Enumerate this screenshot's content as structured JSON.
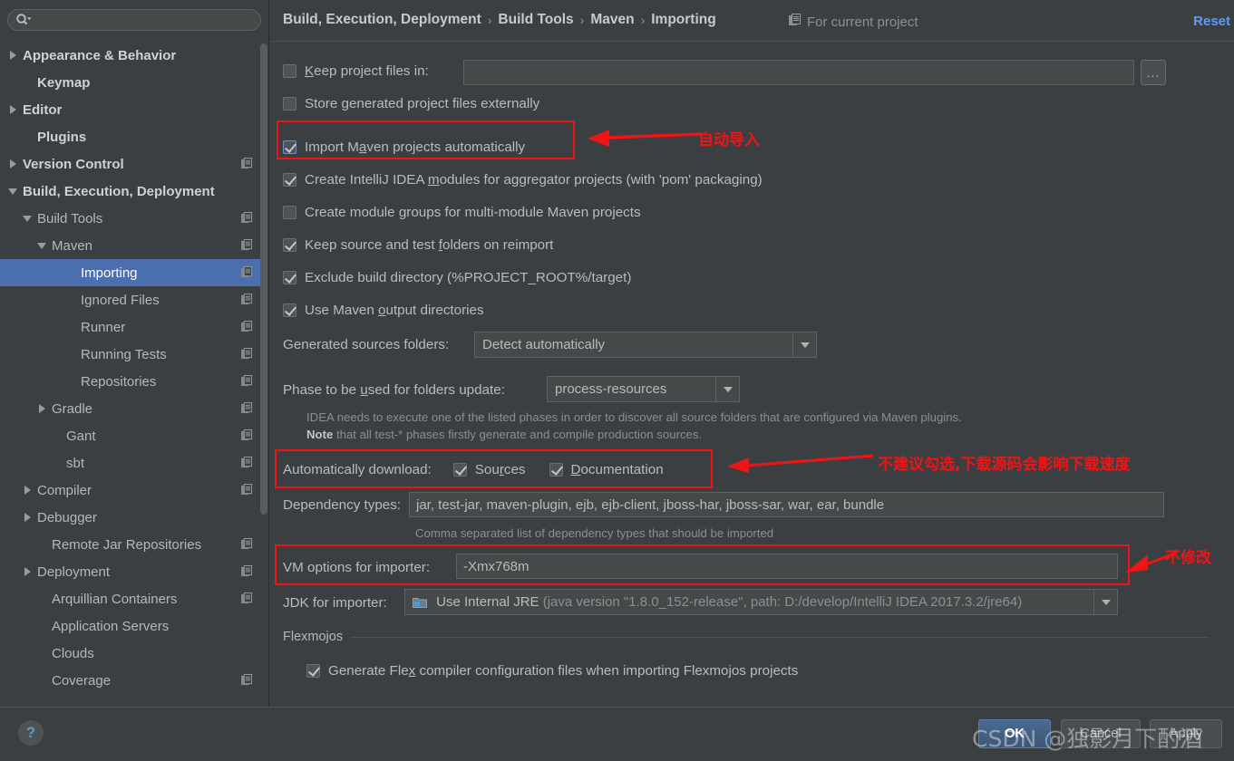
{
  "window": {
    "search_placeholder": "",
    "search_value": ""
  },
  "sidebar": {
    "items": [
      {
        "label": "Appearance & Behavior",
        "indent": 0,
        "arrow": "collapsed",
        "bold": true,
        "copy": false,
        "selected": false
      },
      {
        "label": "Keymap",
        "indent": 1,
        "arrow": "none",
        "bold": true,
        "copy": false,
        "selected": false
      },
      {
        "label": "Editor",
        "indent": 0,
        "arrow": "collapsed",
        "bold": true,
        "copy": false,
        "selected": false
      },
      {
        "label": "Plugins",
        "indent": 1,
        "arrow": "none",
        "bold": true,
        "copy": false,
        "selected": false
      },
      {
        "label": "Version Control",
        "indent": 0,
        "arrow": "collapsed",
        "bold": true,
        "copy": true,
        "selected": false
      },
      {
        "label": "Build, Execution, Deployment",
        "indent": 0,
        "arrow": "expanded",
        "bold": true,
        "copy": false,
        "selected": false
      },
      {
        "label": "Build Tools",
        "indent": 1,
        "arrow": "expanded",
        "bold": false,
        "copy": true,
        "selected": false
      },
      {
        "label": "Maven",
        "indent": 2,
        "arrow": "expanded",
        "bold": false,
        "copy": true,
        "selected": false
      },
      {
        "label": "Importing",
        "indent": 4,
        "arrow": "none",
        "bold": false,
        "copy": true,
        "selected": true
      },
      {
        "label": "Ignored Files",
        "indent": 4,
        "arrow": "none",
        "bold": false,
        "copy": true,
        "selected": false
      },
      {
        "label": "Runner",
        "indent": 4,
        "arrow": "none",
        "bold": false,
        "copy": true,
        "selected": false
      },
      {
        "label": "Running Tests",
        "indent": 4,
        "arrow": "none",
        "bold": false,
        "copy": true,
        "selected": false
      },
      {
        "label": "Repositories",
        "indent": 4,
        "arrow": "none",
        "bold": false,
        "copy": true,
        "selected": false
      },
      {
        "label": "Gradle",
        "indent": 2,
        "arrow": "collapsed",
        "bold": false,
        "copy": true,
        "selected": false
      },
      {
        "label": "Gant",
        "indent": 3,
        "arrow": "none",
        "bold": false,
        "copy": true,
        "selected": false
      },
      {
        "label": "sbt",
        "indent": 3,
        "arrow": "none",
        "bold": false,
        "copy": true,
        "selected": false
      },
      {
        "label": "Compiler",
        "indent": 1,
        "arrow": "collapsed",
        "bold": false,
        "copy": true,
        "selected": false
      },
      {
        "label": "Debugger",
        "indent": 1,
        "arrow": "collapsed",
        "bold": false,
        "copy": false,
        "selected": false
      },
      {
        "label": "Remote Jar Repositories",
        "indent": 2,
        "arrow": "none",
        "bold": false,
        "copy": true,
        "selected": false
      },
      {
        "label": "Deployment",
        "indent": 1,
        "arrow": "collapsed",
        "bold": false,
        "copy": true,
        "selected": false
      },
      {
        "label": "Arquillian Containers",
        "indent": 2,
        "arrow": "none",
        "bold": false,
        "copy": true,
        "selected": false
      },
      {
        "label": "Application Servers",
        "indent": 2,
        "arrow": "none",
        "bold": false,
        "copy": false,
        "selected": false
      },
      {
        "label": "Clouds",
        "indent": 2,
        "arrow": "none",
        "bold": false,
        "copy": false,
        "selected": false
      },
      {
        "label": "Coverage",
        "indent": 2,
        "arrow": "none",
        "bold": false,
        "copy": true,
        "selected": false
      }
    ]
  },
  "header": {
    "breadcrumb": [
      "Build, Execution, Deployment",
      "Build Tools",
      "Maven",
      "Importing"
    ],
    "separator": "›",
    "scope_label": "For current project",
    "reset_label": "Reset"
  },
  "form": {
    "keep_project_files": {
      "label": "Keep project files in:",
      "checked": false,
      "value": "",
      "browse_label": "..."
    },
    "store_generated_externally": {
      "label": "Store generated project files externally",
      "checked": false
    },
    "import_maven_auto": {
      "label": "Import Maven projects automatically",
      "checked": true
    },
    "create_idea_modules": {
      "label": "Create IntelliJ IDEA modules for aggregator projects (with 'pom' packaging)",
      "checked": true
    },
    "create_module_groups": {
      "label": "Create module groups for multi-module Maven projects",
      "checked": false
    },
    "keep_source_test_folders": {
      "label": "Keep source and test folders on reimport",
      "checked": true
    },
    "exclude_build_dir": {
      "label": "Exclude build directory (%PROJECT_ROOT%/target)",
      "checked": true
    },
    "use_maven_output_dirs": {
      "label": "Use Maven output directories",
      "checked": true
    },
    "generated_sources_folders": {
      "label": "Generated sources folders:",
      "value": "Detect automatically"
    },
    "phase_for_folders_update": {
      "label": "Phase to be used for folders update:",
      "value": "process-resources"
    },
    "phase_hint_line1": "IDEA needs to execute one of the listed phases in order to discover all source folders that are configured via Maven plugins.",
    "phase_hint_note_bold": "Note",
    "phase_hint_line2": " that all test-* phases firstly generate and compile production sources.",
    "automatically_download": {
      "label": "Automatically download:",
      "sources_label": "Sources",
      "sources_checked": true,
      "documentation_label": "Documentation",
      "documentation_checked": true
    },
    "dependency_types": {
      "label": "Dependency types:",
      "value": "jar, test-jar, maven-plugin, ejb, ejb-client, jboss-har, jboss-sar, war, ear, bundle",
      "hint": "Comma separated list of dependency types that should be imported"
    },
    "vm_options": {
      "label": "VM options for importer:",
      "value": "-Xmx768m"
    },
    "jdk_for_importer": {
      "label": "JDK for importer:",
      "value": "Use Internal JRE",
      "detail": " (java version \"1.8.0_152-release\", path: D:/develop/IntelliJ IDEA 2017.3.2/jre64)"
    },
    "flexmojos": {
      "group_label": "Flexmojos",
      "generate_flex_label": "Generate Flex compiler configuration files when importing Flexmojos projects",
      "generate_flex_checked": true
    }
  },
  "annotations": {
    "auto_import": "自动导入",
    "no_download_sources": "不建议勾选,下载源码会影响下载速度",
    "no_modify": "不修改",
    "box_color": "#f01414"
  },
  "footer": {
    "help_label": "?",
    "ok_label": "OK",
    "cancel_label": "Cancel",
    "apply_label": "Apply",
    "watermark": "CSDN @独影月下酌酒"
  }
}
